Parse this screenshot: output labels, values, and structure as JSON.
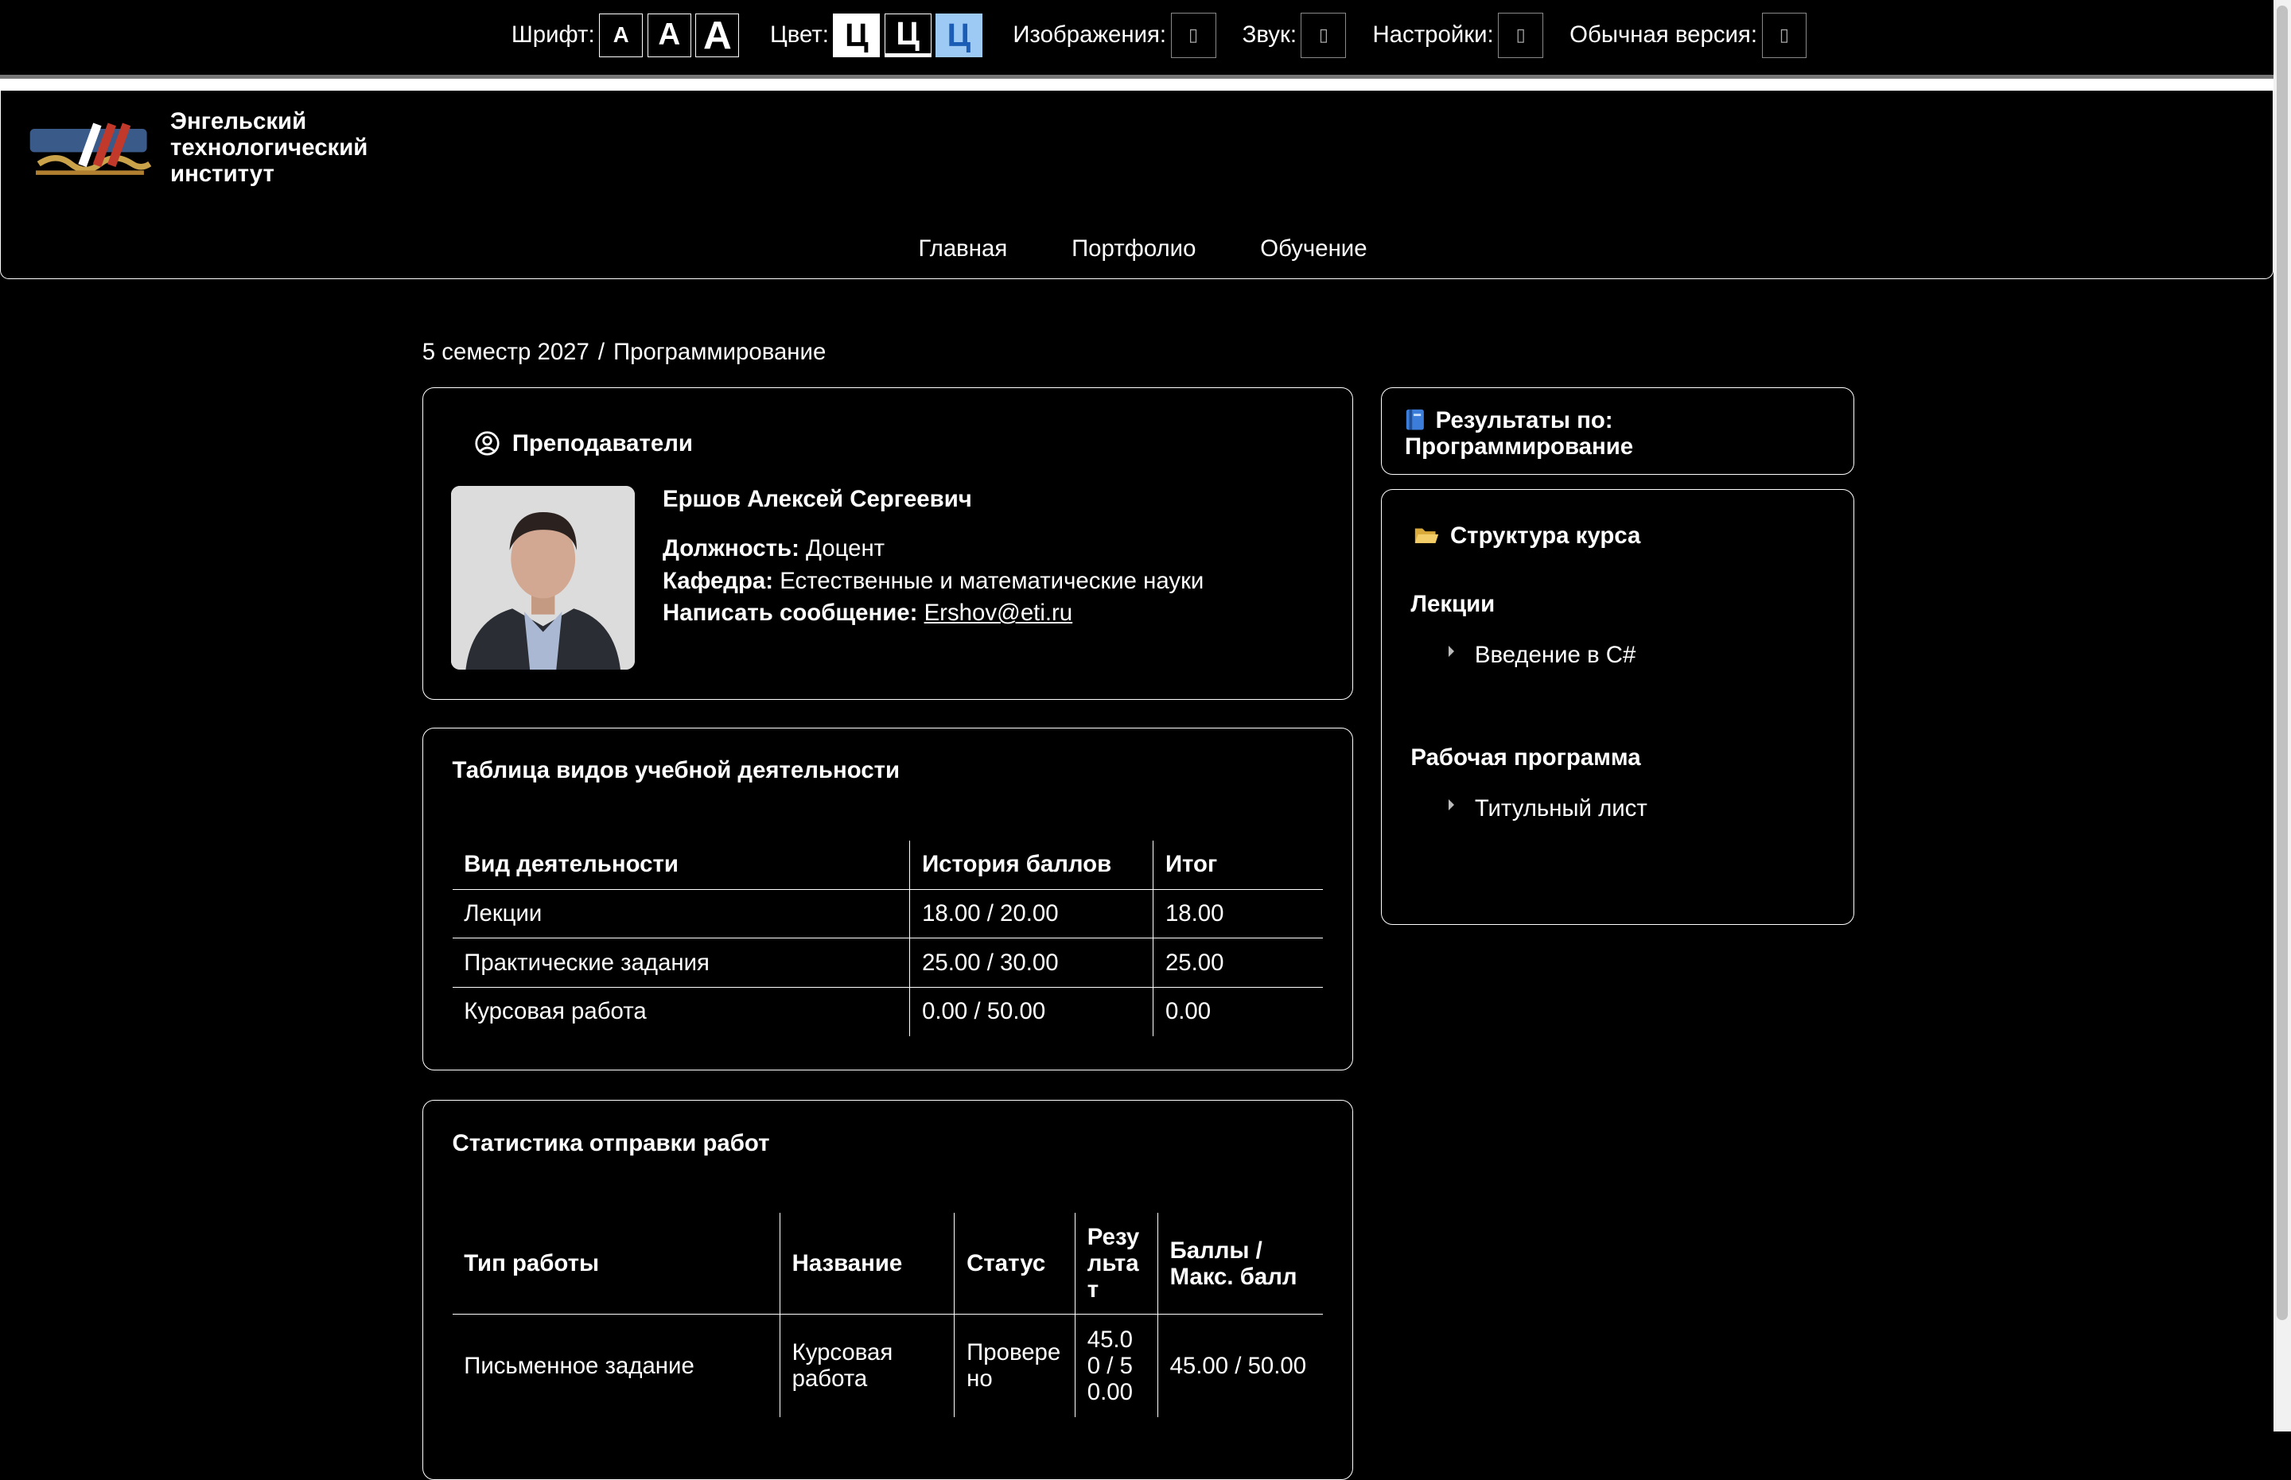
{
  "toolbar": {
    "font_label": "Шрифт:",
    "font_buttons": [
      "A",
      "A",
      "A"
    ],
    "color_label": "Цвет:",
    "color_buttons": [
      "Ц",
      "Ц",
      "Ц"
    ],
    "images_label": "Изображения:",
    "sound_label": "Звук:",
    "settings_label": "Настройки:",
    "normal_label": "Обычная версия:",
    "box_glyph": "▯"
  },
  "header": {
    "institute_line1": "Энгельский",
    "institute_line2": "технологический",
    "institute_line3": "институт",
    "nav": [
      "Главная",
      "Портфолио",
      "Обучение"
    ]
  },
  "breadcrumb": {
    "semester": "5 семестр 2027",
    "sep": "/",
    "course": "Программирование"
  },
  "teachers": {
    "title": "Преподаватели",
    "name": "Ершов Алексей Сергеевич",
    "position_label": "Должность:",
    "position": "Доцент",
    "dept_label": "Кафедра:",
    "dept": "Естественные и математические науки",
    "msg_label": "Написать сообщение:",
    "email": "Ershov@eti.ru"
  },
  "activities": {
    "title": "Таблица видов учебной деятельности",
    "headers": [
      "Вид деятельности",
      "История баллов",
      "Итог"
    ],
    "rows": [
      [
        "Лекции",
        "18.00 / 20.00",
        "18.00"
      ],
      [
        "Практические задания",
        "25.00 / 30.00",
        "25.00"
      ],
      [
        "Курсовая работа",
        "0.00 / 50.00",
        "0.00"
      ]
    ]
  },
  "stats": {
    "title": "Статистика отправки работ",
    "headers": [
      "Тип работы",
      "Название",
      "Статус",
      "Резу льта т",
      "Баллы / Макс. балл"
    ],
    "rows": [
      [
        "Письменное задание",
        "Курсовая работа",
        "Провере но",
        "45.00 / 50.00",
        "45.00 / 50.00"
      ]
    ]
  },
  "results": {
    "title_line1": "Результаты по:",
    "title_line2": "Программирование"
  },
  "structure": {
    "title": "Структура курса",
    "sections": [
      {
        "name": "Лекции",
        "items": [
          "Введение в C#"
        ]
      },
      {
        "name": "Рабочая программа",
        "items": [
          "Титульный лист"
        ]
      }
    ]
  },
  "colors": {
    "accent_blue": "#9dc9f5",
    "background": "#000000",
    "text": "#ffffff"
  }
}
